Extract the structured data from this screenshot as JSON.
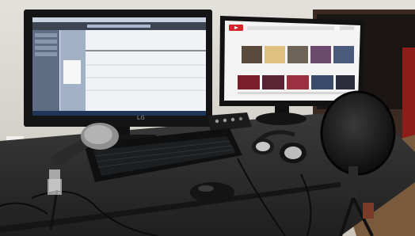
{
  "scene": {
    "colors": {
      "wall": "#d8d5ce",
      "desk": "#2c2c2c",
      "monitor_bezel": "#151515",
      "daw_screen": "#e6eaf1",
      "youtube_screen": "#f3f3f3",
      "youtube_red": "#d8252a"
    },
    "left_monitor_brand": "LG"
  }
}
